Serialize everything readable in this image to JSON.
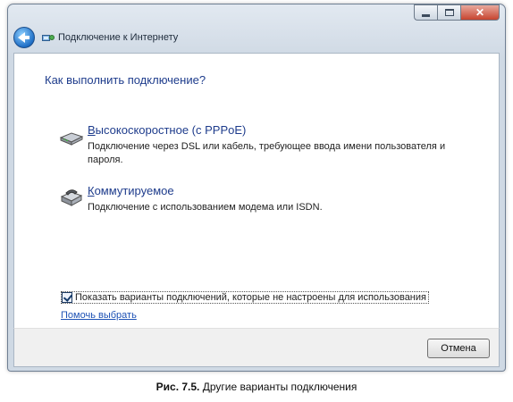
{
  "window": {
    "title": "Подключение к Интернету",
    "close_glyph": "✕"
  },
  "instruction": "Как выполнить подключение?",
  "options": [
    {
      "title_accel": "В",
      "title_rest": "ысокоскоростное (с PPPoE)",
      "description": "Подключение через DSL или кабель, требующее ввода имени пользователя и пароля.",
      "icon": "dsl-modem-icon"
    },
    {
      "title_accel": "К",
      "title_rest": "оммутируемое",
      "description": "Подключение с использованием модема или ISDN.",
      "icon": "dialup-modem-icon"
    }
  ],
  "show_unconfigured": {
    "checked": true,
    "label": "Показать варианты подключений, которые не настроены для использования"
  },
  "help_link": "Помочь выбрать",
  "buttons": {
    "cancel": "Отмена"
  },
  "figure_caption": {
    "number": "Рис. 7.5.",
    "text": "Другие варианты подключения"
  }
}
